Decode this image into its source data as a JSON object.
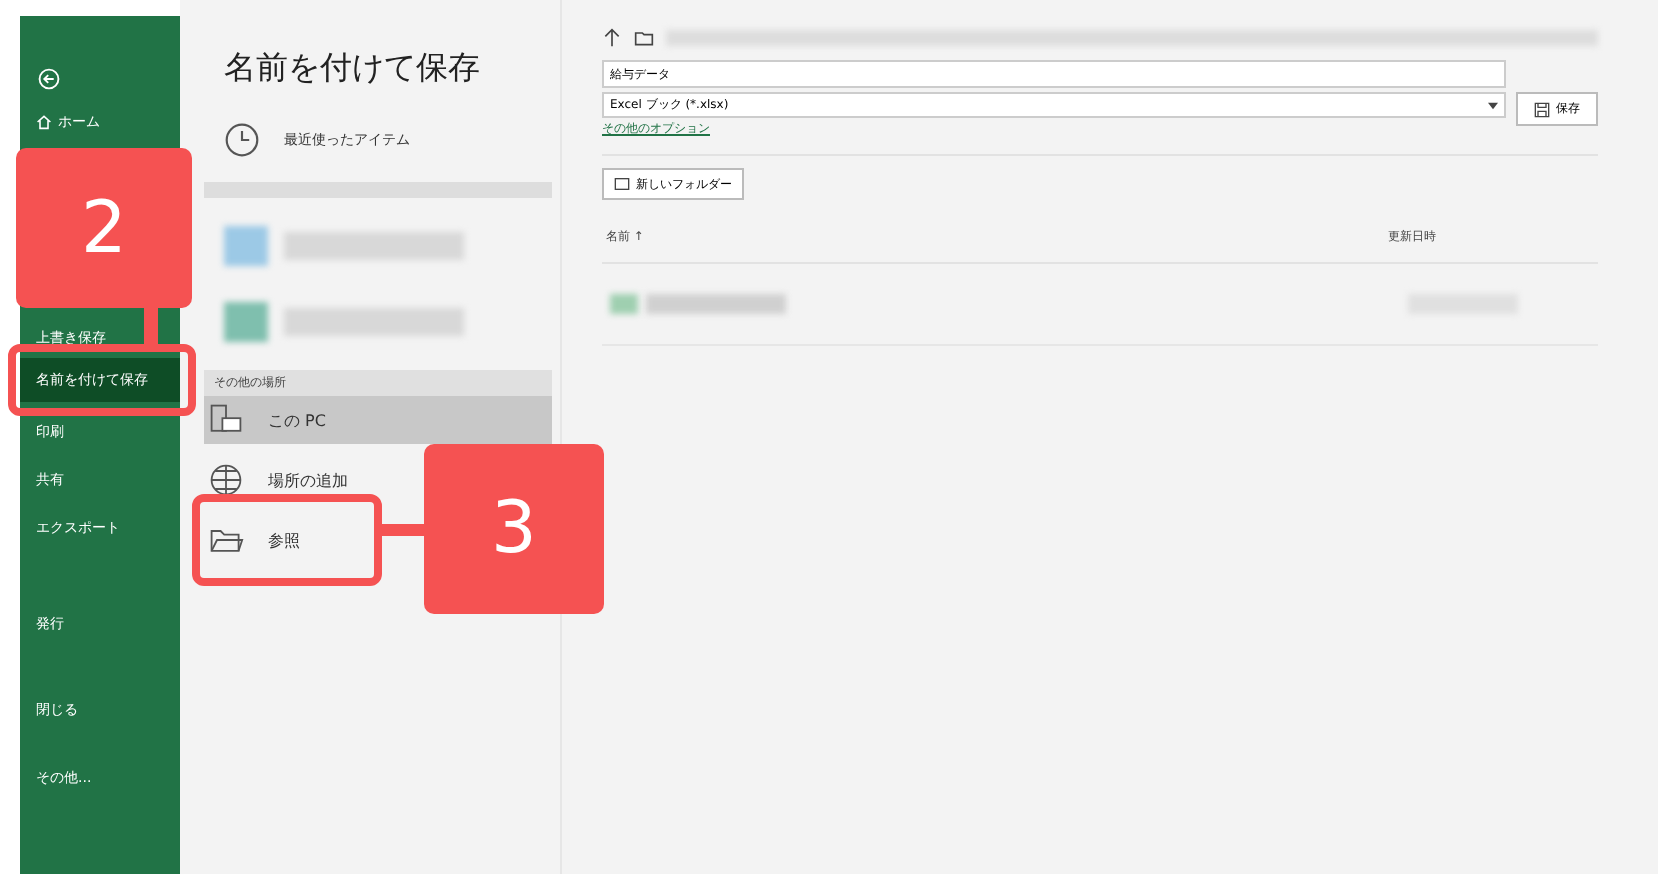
{
  "sidebar": {
    "items": [
      {
        "label": "ホーム",
        "selected": false,
        "kind": "home"
      },
      {
        "label": "上書き保存",
        "selected": false
      },
      {
        "label": "名前を付けて保存",
        "selected": true
      },
      {
        "label": "印刷",
        "selected": false
      },
      {
        "label": "共有",
        "selected": false
      },
      {
        "label": "エクスポート",
        "selected": false
      },
      {
        "label": "発行",
        "selected": false
      },
      {
        "label": "閉じる",
        "selected": false
      },
      {
        "label": "その他...",
        "selected": false
      }
    ]
  },
  "title": "名前を付けて保存",
  "locations": {
    "recent": "最近使ったアイテム",
    "other_header": "その他の場所",
    "items": [
      {
        "label": "この PC",
        "kind": "pc",
        "selected": true
      },
      {
        "label": "場所の追加",
        "kind": "globe",
        "selected": false
      },
      {
        "label": "参照",
        "kind": "folder",
        "selected": false
      }
    ]
  },
  "save": {
    "filename": "給与データ",
    "file_type": "Excel ブック (*.xlsx)",
    "more_options": "その他のオプション",
    "save_button": "保存",
    "new_folder": "新しいフォルダー",
    "columns": [
      "名前 ↑",
      "更新日時"
    ]
  },
  "callouts": [
    "2",
    "3"
  ]
}
